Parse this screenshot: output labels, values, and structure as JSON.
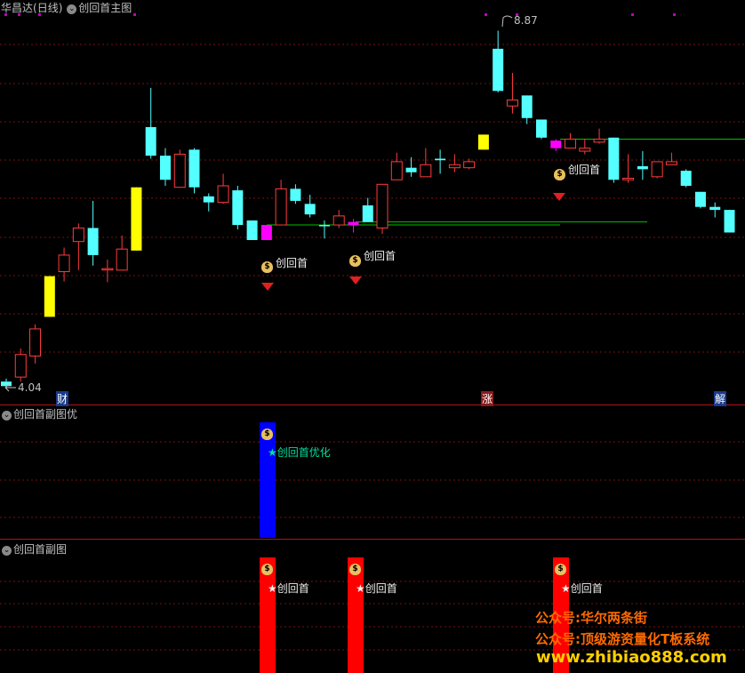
{
  "main_panel": {
    "stock_name": "华昌达",
    "period": "(日线)",
    "indicator_title": "创回首主图",
    "high_label": "8.87",
    "low_label": "4.04",
    "signal_label": "创回首",
    "event_markers": [
      "财",
      "涨",
      "解"
    ]
  },
  "sub_panel_1": {
    "title": "创回首副图优",
    "signal_label": "★创回首优化"
  },
  "sub_panel_2": {
    "title": "创回首副图",
    "signal_label": "★创回首"
  },
  "watermarks": [
    "公众号:华尔两条街",
    "公众号:顶级游资量化T板系统",
    "www.zhibiao888.com"
  ],
  "icons": {
    "signal": "money-bag-icon",
    "diamond": "red-diamond-icon"
  },
  "colors": {
    "up_candle": "#ff3c3c",
    "down_candle": "#54ffff",
    "strong_bar": "#ffff00",
    "signal_bar": "#ff00ff",
    "level_line": "#00c000",
    "sub_bar_optimized": "#0000ff",
    "sub_bar": "#ff0000",
    "watermark_orange": "#ff6a00"
  },
  "chart_data": {
    "type": "candlestick",
    "y_high_marker": 8.87,
    "y_low_marker": 4.04,
    "candles": [
      {
        "o": 4.06,
        "h": 4.16,
        "l": 4.04,
        "c": 4.12,
        "s": "dn"
      },
      {
        "o": 4.18,
        "h": 4.56,
        "l": 4.12,
        "c": 4.48,
        "s": "up"
      },
      {
        "o": 4.46,
        "h": 4.88,
        "l": 4.36,
        "c": 4.82,
        "s": "up"
      },
      {
        "o": 4.98,
        "h": 5.52,
        "l": 4.98,
        "c": 5.52,
        "s": "yl"
      },
      {
        "o": 5.58,
        "h": 5.9,
        "l": 5.45,
        "c": 5.8,
        "s": "up"
      },
      {
        "o": 5.98,
        "h": 6.22,
        "l": 5.6,
        "c": 6.16,
        "s": "up"
      },
      {
        "o": 6.16,
        "h": 6.52,
        "l": 5.66,
        "c": 5.8,
        "s": "dn"
      },
      {
        "o": 5.62,
        "h": 5.74,
        "l": 5.44,
        "c": 5.61,
        "s": "up"
      },
      {
        "o": 5.6,
        "h": 6.06,
        "l": 5.6,
        "c": 5.88,
        "s": "up"
      },
      {
        "o": 5.86,
        "h": 6.7,
        "l": 5.86,
        "c": 6.7,
        "s": "yl"
      },
      {
        "o": 7.5,
        "h": 8.02,
        "l": 7.08,
        "c": 7.12,
        "s": "dn"
      },
      {
        "o": 7.12,
        "h": 7.22,
        "l": 6.72,
        "c": 6.8,
        "s": "dn"
      },
      {
        "o": 6.7,
        "h": 7.2,
        "l": 6.7,
        "c": 7.14,
        "s": "up"
      },
      {
        "o": 7.2,
        "h": 7.22,
        "l": 6.62,
        "c": 6.7,
        "s": "dn"
      },
      {
        "o": 6.58,
        "h": 6.62,
        "l": 6.38,
        "c": 6.5,
        "s": "dn"
      },
      {
        "o": 6.5,
        "h": 6.88,
        "l": 6.48,
        "c": 6.72,
        "s": "up"
      },
      {
        "o": 6.66,
        "h": 6.72,
        "l": 6.14,
        "c": 6.2,
        "s": "dn"
      },
      {
        "o": 6.26,
        "h": 6.26,
        "l": 6.0,
        "c": 6.0,
        "s": "dn"
      },
      {
        "o": 6.2,
        "h": 6.2,
        "l": 6.0,
        "c": 6.0,
        "s": "mg"
      },
      {
        "o": 6.2,
        "h": 6.8,
        "l": 6.2,
        "c": 6.68,
        "s": "up"
      },
      {
        "o": 6.68,
        "h": 6.74,
        "l": 6.48,
        "c": 6.52,
        "s": "dn"
      },
      {
        "o": 6.48,
        "h": 6.6,
        "l": 6.3,
        "c": 6.34,
        "s": "dn"
      },
      {
        "o": 6.2,
        "h": 6.26,
        "l": 6.02,
        "c": 6.2,
        "s": "dn"
      },
      {
        "o": 6.2,
        "h": 6.4,
        "l": 6.16,
        "c": 6.32,
        "s": "up"
      },
      {
        "o": 6.24,
        "h": 6.28,
        "l": 6.1,
        "c": 6.2,
        "s": "mg"
      },
      {
        "o": 6.24,
        "h": 6.56,
        "l": 6.24,
        "c": 6.46,
        "s": "dn"
      },
      {
        "o": 6.16,
        "h": 6.72,
        "l": 6.08,
        "c": 6.74,
        "s": "up"
      },
      {
        "o": 6.8,
        "h": 7.16,
        "l": 6.8,
        "c": 7.04,
        "s": "up"
      },
      {
        "o": 6.96,
        "h": 7.1,
        "l": 6.84,
        "c": 6.9,
        "s": "dn"
      },
      {
        "o": 6.84,
        "h": 7.22,
        "l": 6.84,
        "c": 7.0,
        "s": "up"
      },
      {
        "o": 7.08,
        "h": 7.2,
        "l": 6.88,
        "c": 7.06,
        "s": "dn"
      },
      {
        "o": 6.96,
        "h": 7.14,
        "l": 6.9,
        "c": 7.0,
        "s": "up"
      },
      {
        "o": 6.96,
        "h": 7.08,
        "l": 6.94,
        "c": 7.04,
        "s": "up"
      },
      {
        "o": 7.2,
        "h": 7.4,
        "l": 7.2,
        "c": 7.4,
        "s": "yl"
      },
      {
        "o": 8.54,
        "h": 8.78,
        "l": 7.96,
        "c": 7.98,
        "s": "dn"
      },
      {
        "o": 7.78,
        "h": 8.22,
        "l": 7.68,
        "c": 7.86,
        "s": "up"
      },
      {
        "o": 7.92,
        "h": 7.92,
        "l": 7.54,
        "c": 7.62,
        "s": "dn"
      },
      {
        "o": 7.6,
        "h": 7.6,
        "l": 7.34,
        "c": 7.36,
        "s": "dn"
      },
      {
        "o": 7.32,
        "h": 7.34,
        "l": 7.18,
        "c": 7.22,
        "s": "mg"
      },
      {
        "o": 7.22,
        "h": 7.42,
        "l": 7.22,
        "c": 7.34,
        "s": "up"
      },
      {
        "o": 7.18,
        "h": 7.34,
        "l": 7.14,
        "c": 7.22,
        "s": "up"
      },
      {
        "o": 7.3,
        "h": 7.48,
        "l": 7.28,
        "c": 7.34,
        "s": "up"
      },
      {
        "o": 7.36,
        "h": 7.36,
        "l": 6.76,
        "c": 6.8,
        "s": "dn"
      },
      {
        "o": 6.8,
        "h": 7.14,
        "l": 6.76,
        "c": 6.82,
        "s": "up"
      },
      {
        "o": 6.98,
        "h": 7.18,
        "l": 6.8,
        "c": 6.94,
        "s": "dn"
      },
      {
        "o": 6.84,
        "h": 7.0,
        "l": 6.82,
        "c": 7.04,
        "s": "up"
      },
      {
        "o": 7.0,
        "h": 7.16,
        "l": 7.0,
        "c": 7.04,
        "s": "up"
      },
      {
        "o": 6.92,
        "h": 6.94,
        "l": 6.7,
        "c": 6.72,
        "s": "dn"
      },
      {
        "o": 6.64,
        "h": 6.64,
        "l": 6.42,
        "c": 6.44,
        "s": "dn"
      },
      {
        "o": 6.44,
        "h": 6.5,
        "l": 6.3,
        "c": 6.4,
        "s": "dn"
      },
      {
        "o": 6.4,
        "h": 6.4,
        "l": 6.1,
        "c": 6.1,
        "s": "dn"
      }
    ],
    "level_lines": [
      6.2,
      6.24,
      7.34
    ]
  }
}
